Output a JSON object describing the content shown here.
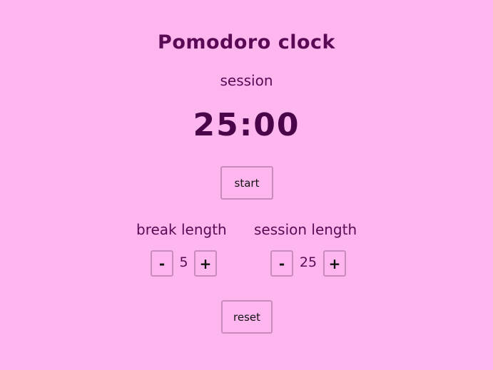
{
  "title": "Pomodoro clock",
  "mode_label": "session",
  "time_display": "25:00",
  "start_button": "start",
  "reset_button": "reset",
  "break": {
    "label": "break length",
    "value": "5",
    "decrement": "-",
    "increment": "+"
  },
  "session": {
    "label": "session length",
    "value": "25",
    "decrement": "-",
    "increment": "+"
  },
  "colors": {
    "background": "#feb6ef",
    "text": "#5a0a55",
    "button_border": "#c98bbd"
  }
}
